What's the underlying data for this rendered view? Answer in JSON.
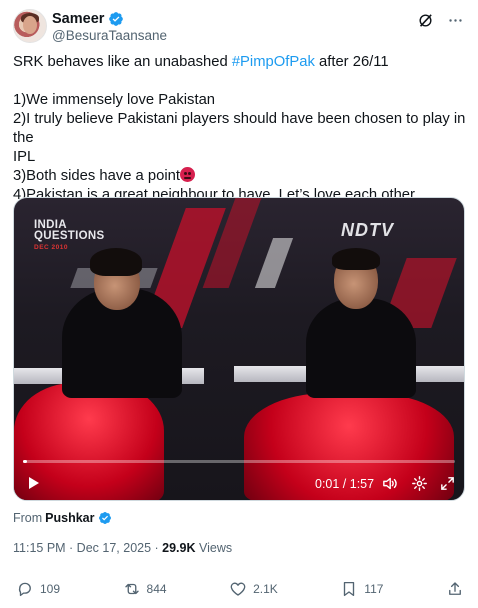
{
  "author": {
    "display_name": "Sameer",
    "handle": "@BesuraTaansane"
  },
  "header_icons": [
    "grok-icon",
    "more-icon"
  ],
  "tweet": {
    "line1_prefix": "SRK behaves like an unabashed ",
    "hashtag": "#PimpOfPak",
    "line1_suffix": " after 26/11",
    "points": [
      "1)We immensely love Pakistan",
      "2)I truly believe Pakistani players should have been chosen to play in the",
      "IPL",
      "3)Both sides have a point",
      "4)Pakistan is a great neighbour to have. Let’s love each other"
    ]
  },
  "video": {
    "overlay_left_title": "INDIA\nQUESTIONS",
    "overlay_left_sub": "DEC 2010",
    "overlay_right": "NDTV",
    "time": "0:01 / 1:57",
    "progress": 0.009
  },
  "source": {
    "prefix": "From",
    "name": "Pushkar"
  },
  "meta": {
    "time": "11:15 PM · Dec 17, 2025 · ",
    "views_count": "29.9K",
    "views_label": " Views"
  },
  "actions": {
    "replies": "109",
    "reposts": "844",
    "likes": "2.1K",
    "bookmarks": "117"
  },
  "colors": {
    "link": "#1d9bf0",
    "secondary": "#536471",
    "verified": "#1d9bf0"
  }
}
